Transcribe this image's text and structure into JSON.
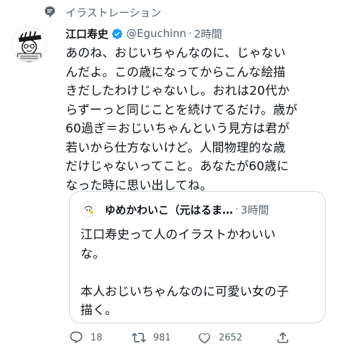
{
  "topic": {
    "label": "イラストレーション",
    "icon": "topic-icon"
  },
  "tweet": {
    "author_name": "江口寿史",
    "verified_icon": "verified-badge-icon",
    "handle": "@Eguchinn",
    "separator": "·",
    "time": "2時間",
    "text": "あのね、おじいちゃんなのに、じゃない\nんだよ。この歳になってからこんな絵描\nきだしたわけじゃないし。おれは20代か\nらずーっと同じことを続けてるだけ。歳が\n60過ぎ＝おじいちゃんという見方は君が\n若いから仕方ないけど。人間物理的な歳\nだけじゃないってこと。あなたが60歳に\nなった時に思い出してね。"
  },
  "quote": {
    "author_name": "ゆめかわいこ（元はるま…",
    "separator": "·",
    "time": "3時間",
    "text": "江口寿史って人のイラストかわいい\nな。\n\n本人おじいちゃんなのに可愛い女の子\n描く。"
  },
  "actions": {
    "reply_count": "18",
    "retweet_count": "981",
    "like_count": "2652"
  },
  "colors": {
    "secondary_text": "#536471",
    "verified_blue": "#1d9bf0",
    "border": "#cfd9de"
  }
}
